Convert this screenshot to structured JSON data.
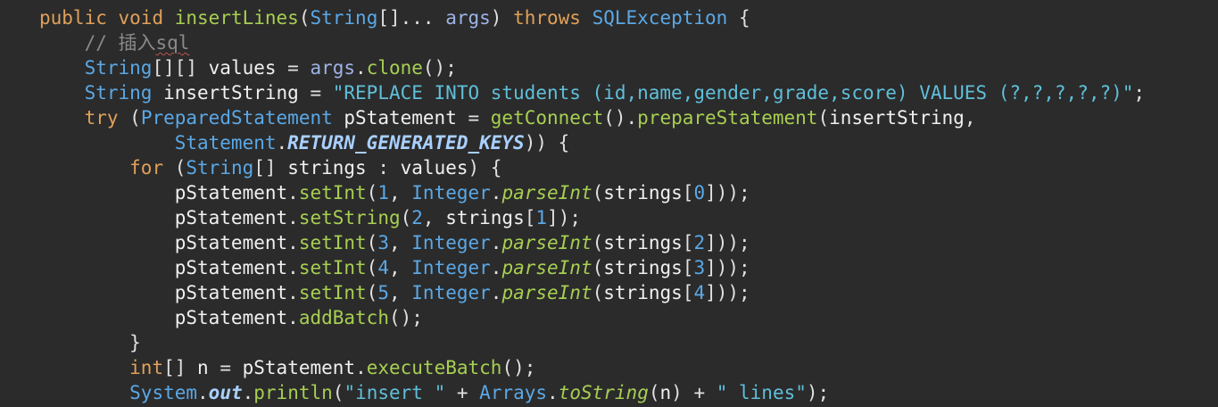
{
  "editor": {
    "language": "Java",
    "lines": [
      {
        "tokens": [
          [
            "kw",
            "public"
          ],
          [
            "pr",
            " "
          ],
          [
            "kw",
            "void"
          ],
          [
            "pr",
            " "
          ],
          [
            "fn",
            "insertLines"
          ],
          [
            "pr",
            "("
          ],
          [
            "ty",
            "String"
          ],
          [
            "pr",
            "[]... "
          ],
          [
            "pm",
            "args"
          ],
          [
            "pr",
            ") "
          ],
          [
            "kw",
            "throws"
          ],
          [
            "pr",
            " "
          ],
          [
            "ty",
            "SQLException"
          ],
          [
            "pr",
            " {"
          ]
        ]
      },
      {
        "tokens": [
          [
            "pr",
            "    "
          ],
          [
            "cm",
            "// 插入"
          ],
          [
            "cm squig",
            "sql"
          ]
        ]
      },
      {
        "tokens": [
          [
            "pr",
            "    "
          ],
          [
            "ty",
            "String"
          ],
          [
            "pr",
            "[][] "
          ],
          [
            "lv",
            "values"
          ],
          [
            "pr",
            " = "
          ],
          [
            "pm",
            "args"
          ],
          [
            "pr",
            "."
          ],
          [
            "fn",
            "clone"
          ],
          [
            "pr",
            "();"
          ]
        ]
      },
      {
        "tokens": [
          [
            "pr",
            "    "
          ],
          [
            "ty",
            "String"
          ],
          [
            "pr",
            " "
          ],
          [
            "lv",
            "insertString"
          ],
          [
            "pr",
            " = "
          ],
          [
            "st",
            "\"REPLACE INTO students (id,name,gender,grade,score) VALUES (?,?,?,?,?)\""
          ],
          [
            "pr",
            ";"
          ]
        ]
      },
      {
        "tokens": [
          [
            "pr",
            "    "
          ],
          [
            "kw",
            "try"
          ],
          [
            "pr",
            " ("
          ],
          [
            "ty",
            "PreparedStatement"
          ],
          [
            "pr",
            " "
          ],
          [
            "lv",
            "pStatement"
          ],
          [
            "pr",
            " = "
          ],
          [
            "fn",
            "getConnect"
          ],
          [
            "pr",
            "()."
          ],
          [
            "fn",
            "prepareStatement"
          ],
          [
            "pr",
            "("
          ],
          [
            "lv",
            "insertString"
          ],
          [
            "pr",
            ","
          ]
        ]
      },
      {
        "tokens": [
          [
            "pr",
            "            "
          ],
          [
            "ty",
            "Statement"
          ],
          [
            "pr",
            "."
          ],
          [
            "sc",
            "RETURN_GENERATED_KEYS"
          ],
          [
            "pr",
            ")) {"
          ]
        ]
      },
      {
        "tokens": [
          [
            "pr",
            "        "
          ],
          [
            "kw",
            "for"
          ],
          [
            "pr",
            " ("
          ],
          [
            "ty",
            "String"
          ],
          [
            "pr",
            "[] "
          ],
          [
            "lv",
            "strings"
          ],
          [
            "pr",
            " : "
          ],
          [
            "lv",
            "values"
          ],
          [
            "pr",
            ") {"
          ]
        ]
      },
      {
        "tokens": [
          [
            "pr",
            "            "
          ],
          [
            "lv",
            "pStatement"
          ],
          [
            "pr",
            "."
          ],
          [
            "fn",
            "setInt"
          ],
          [
            "pr",
            "("
          ],
          [
            "nm",
            "1"
          ],
          [
            "pr",
            ", "
          ],
          [
            "ty",
            "Integer"
          ],
          [
            "pr",
            "."
          ],
          [
            "sf",
            "parseInt"
          ],
          [
            "pr",
            "("
          ],
          [
            "lv",
            "strings"
          ],
          [
            "pr",
            "["
          ],
          [
            "nm",
            "0"
          ],
          [
            "pr",
            "]));"
          ]
        ]
      },
      {
        "tokens": [
          [
            "pr",
            "            "
          ],
          [
            "lv",
            "pStatement"
          ],
          [
            "pr",
            "."
          ],
          [
            "fn",
            "setString"
          ],
          [
            "pr",
            "("
          ],
          [
            "nm",
            "2"
          ],
          [
            "pr",
            ", "
          ],
          [
            "lv",
            "strings"
          ],
          [
            "pr",
            "["
          ],
          [
            "nm",
            "1"
          ],
          [
            "pr",
            "]);"
          ]
        ]
      },
      {
        "tokens": [
          [
            "pr",
            "            "
          ],
          [
            "lv",
            "pStatement"
          ],
          [
            "pr",
            "."
          ],
          [
            "fn",
            "setInt"
          ],
          [
            "pr",
            "("
          ],
          [
            "nm",
            "3"
          ],
          [
            "pr",
            ", "
          ],
          [
            "ty",
            "Integer"
          ],
          [
            "pr",
            "."
          ],
          [
            "sf",
            "parseInt"
          ],
          [
            "pr",
            "("
          ],
          [
            "lv",
            "strings"
          ],
          [
            "pr",
            "["
          ],
          [
            "nm",
            "2"
          ],
          [
            "pr",
            "]));"
          ]
        ]
      },
      {
        "tokens": [
          [
            "pr",
            "            "
          ],
          [
            "lv",
            "pStatement"
          ],
          [
            "pr",
            "."
          ],
          [
            "fn",
            "setInt"
          ],
          [
            "pr",
            "("
          ],
          [
            "nm",
            "4"
          ],
          [
            "pr",
            ", "
          ],
          [
            "ty",
            "Integer"
          ],
          [
            "pr",
            "."
          ],
          [
            "sf",
            "parseInt"
          ],
          [
            "pr",
            "("
          ],
          [
            "lv",
            "strings"
          ],
          [
            "pr",
            "["
          ],
          [
            "nm",
            "3"
          ],
          [
            "pr",
            "]));"
          ]
        ]
      },
      {
        "tokens": [
          [
            "pr",
            "            "
          ],
          [
            "lv",
            "pStatement"
          ],
          [
            "pr",
            "."
          ],
          [
            "fn",
            "setInt"
          ],
          [
            "pr",
            "("
          ],
          [
            "nm",
            "5"
          ],
          [
            "pr",
            ", "
          ],
          [
            "ty",
            "Integer"
          ],
          [
            "pr",
            "."
          ],
          [
            "sf",
            "parseInt"
          ],
          [
            "pr",
            "("
          ],
          [
            "lv",
            "strings"
          ],
          [
            "pr",
            "["
          ],
          [
            "nm",
            "4"
          ],
          [
            "pr",
            "]));"
          ]
        ]
      },
      {
        "tokens": [
          [
            "pr",
            "            "
          ],
          [
            "lv",
            "pStatement"
          ],
          [
            "pr",
            "."
          ],
          [
            "fn",
            "addBatch"
          ],
          [
            "pr",
            "();"
          ]
        ]
      },
      {
        "tokens": [
          [
            "pr",
            "        }"
          ]
        ]
      },
      {
        "tokens": [
          [
            "pr",
            "        "
          ],
          [
            "kw",
            "int"
          ],
          [
            "pr",
            "[] "
          ],
          [
            "lv",
            "n"
          ],
          [
            "pr",
            " = "
          ],
          [
            "lv",
            "pStatement"
          ],
          [
            "pr",
            "."
          ],
          [
            "fn",
            "executeBatch"
          ],
          [
            "pr",
            "();"
          ]
        ]
      },
      {
        "tokens": [
          [
            "pr",
            "        "
          ],
          [
            "ty",
            "System"
          ],
          [
            "pr",
            "."
          ],
          [
            "sfld",
            "out"
          ],
          [
            "pr",
            "."
          ],
          [
            "fn",
            "println"
          ],
          [
            "pr",
            "("
          ],
          [
            "st",
            "\"insert \""
          ],
          [
            "pr",
            " + "
          ],
          [
            "ty",
            "Arrays"
          ],
          [
            "pr",
            "."
          ],
          [
            "sf",
            "toString"
          ],
          [
            "pr",
            "("
          ],
          [
            "lv",
            "n"
          ],
          [
            "pr",
            ") + "
          ],
          [
            "st",
            "\" lines\""
          ],
          [
            "pr",
            ");"
          ]
        ]
      }
    ]
  }
}
